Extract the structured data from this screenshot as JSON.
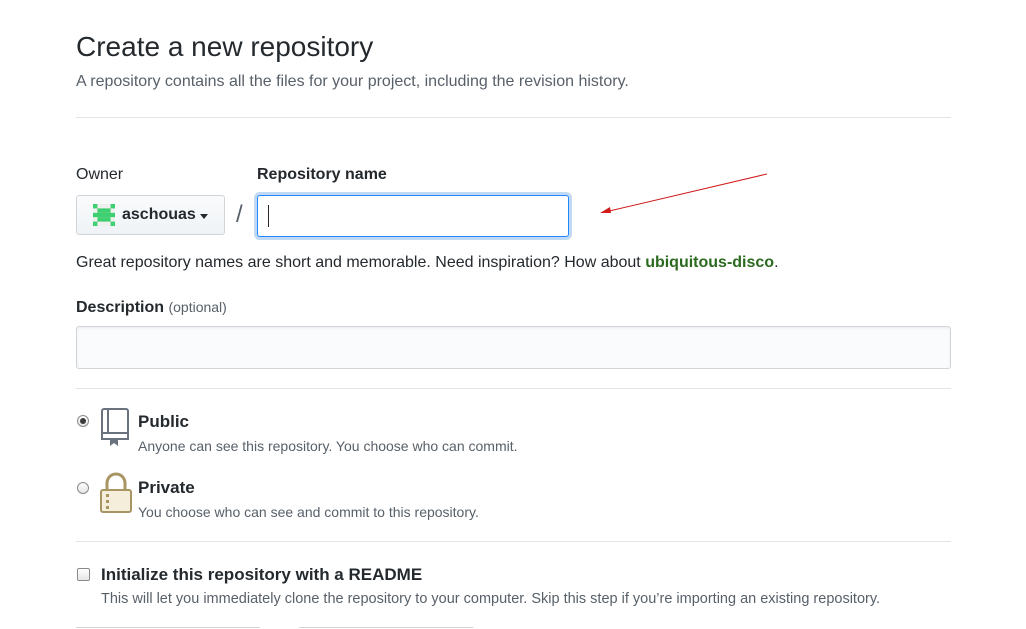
{
  "header": {
    "title": "Create a new repository",
    "subtitle": "A repository contains all the files for your project, including the revision history."
  },
  "owner": {
    "label": "Owner",
    "name": "aschouas",
    "avatar_icon": "identicon-avatar",
    "avatar_color": "#3ecf70"
  },
  "repo_name": {
    "label": "Repository name",
    "separator": "/",
    "value": "",
    "placeholder": ""
  },
  "hint": {
    "prefix": "Great repository names are short and memorable. Need inspiration? How about ",
    "suggestion": "ubiquitous-disco",
    "suffix": "."
  },
  "description": {
    "label": "Description",
    "optional_label": "(optional)",
    "value": ""
  },
  "visibility": {
    "public": {
      "title": "Public",
      "note": "Anyone can see this repository. You choose who can commit.",
      "icon": "repo-book-icon",
      "selected": true
    },
    "private": {
      "title": "Private",
      "note": "You choose who can see and commit to this repository.",
      "icon": "lock-icon",
      "selected": false
    }
  },
  "readme": {
    "label": "Initialize this repository with a README",
    "note": "This will let you immediately clone the repository to your computer. Skip this step if you’re importing an existing repository.",
    "checked": false
  },
  "colors": {
    "focus_border": "#2188ff",
    "suggestion": "#2b6a1f",
    "annotation_arrow": "#d11a1a"
  }
}
